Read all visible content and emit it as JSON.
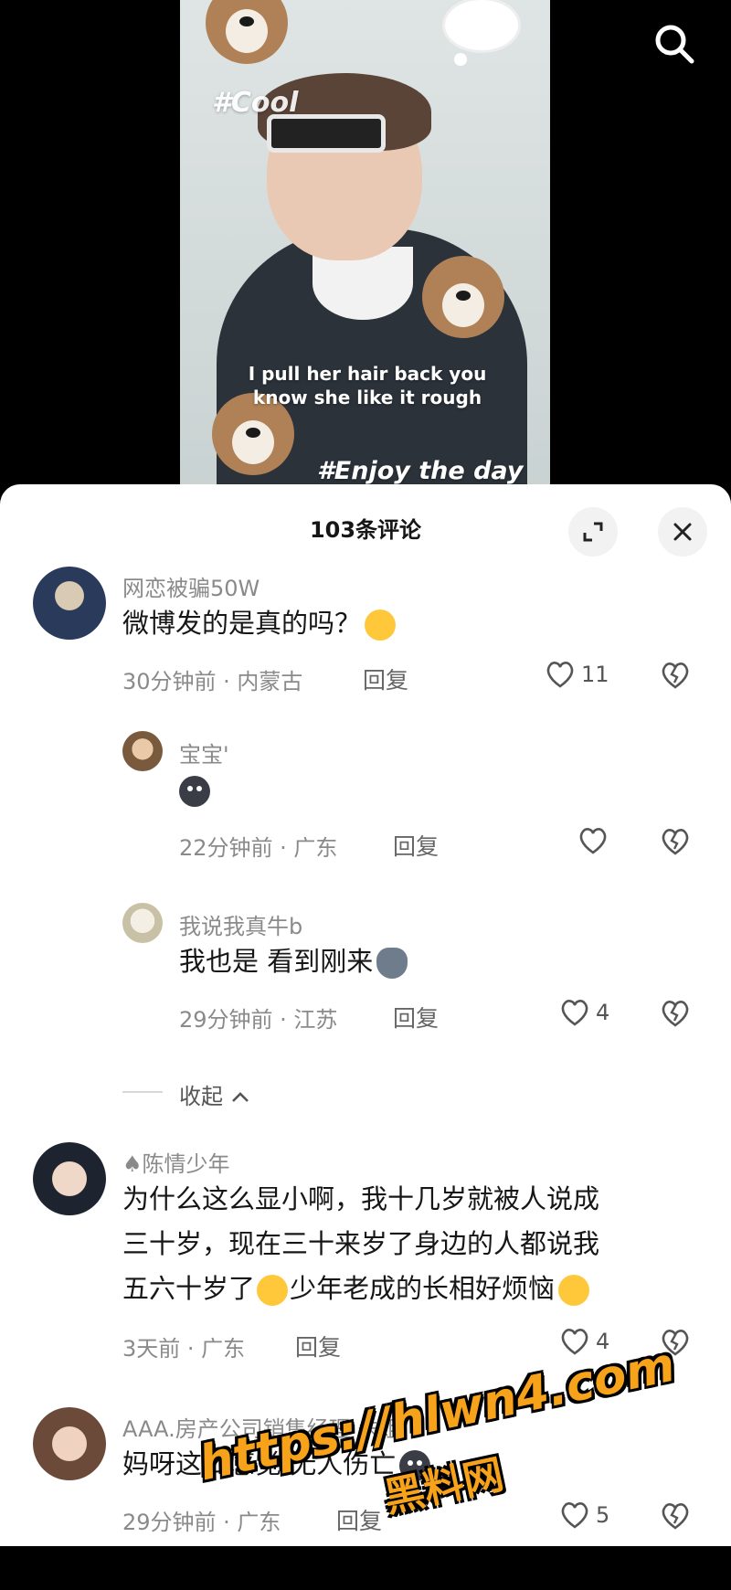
{
  "video": {
    "tag_top": "#Cool",
    "lyric_line1": "I pull her hair back you",
    "lyric_line2": "know she like it rough",
    "tag_bottom": "#Enjoy the day"
  },
  "header": {
    "title": "103条评论"
  },
  "comments": [
    {
      "username": "网恋被骗50W",
      "text": "微博发的是真的吗？",
      "emoji": "rofl",
      "time_location": "30分钟前 · 内蒙古",
      "reply_label": "回复",
      "likes": "11",
      "replies": [
        {
          "username": "宝宝'",
          "text": "",
          "emoji": "dark-blob",
          "time_location": "22分钟前 · 广东",
          "reply_label": "回复",
          "likes": ""
        },
        {
          "username": "我说我真牛b",
          "text": "我也是 看到刚来",
          "emoji": "husky-face",
          "time_location": "29分钟前 · 江苏",
          "reply_label": "回复",
          "likes": "4"
        }
      ]
    },
    {
      "username": "陈情少年",
      "text_line1": "为什么这么显小啊，我十几岁就被人说成",
      "text_line2": "三十岁，现在三十来岁了身边的人都说我",
      "text_line3a": "五六十岁了",
      "text_line3b": "少年老成的长相好烦恼",
      "time_location": "3天前 · 广东",
      "reply_label": "回复",
      "likes": "4"
    },
    {
      "username": "AAA.房产公司销售经理 朱姐",
      "text": "妈呀这么感觉 无人伤亡",
      "emoji": "dark-blob",
      "time_location": "29分钟前 · 广东",
      "reply_label": "回复",
      "likes": "5"
    }
  ],
  "collapse_label": "收起",
  "watermark": {
    "url": "https://hlwn4.com",
    "name": "黑料网"
  },
  "colors": {
    "accent_watermark": "#f6a21a",
    "secondary_text": "#8a8a8a",
    "primary_text": "#161616"
  }
}
